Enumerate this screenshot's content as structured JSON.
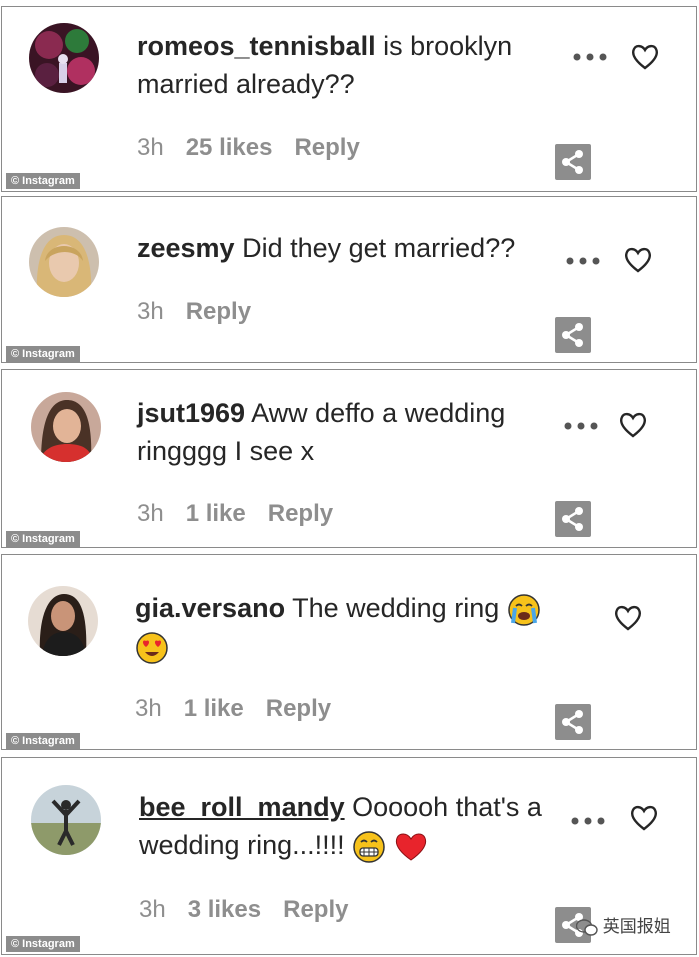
{
  "watermark": "© Instagram",
  "brand_mark": "英国报姐",
  "comments": [
    {
      "username": "romeos_tennisball",
      "text": "is brooklyn married already??",
      "time": "3h",
      "likes": "25 likes",
      "reply": "Reply",
      "avatar": "avatar-colorful-scene"
    },
    {
      "username": "zeesmy",
      "text": "Did they get married??",
      "time": "3h",
      "likes": "",
      "reply": "Reply",
      "avatar": "avatar-blonde-woman"
    },
    {
      "username": "jsut1969",
      "text": "Aww deffo a wedding ringggg I see x",
      "time": "3h",
      "likes": "1 like",
      "reply": "Reply",
      "avatar": "avatar-woman-red-top"
    },
    {
      "username": "gia.versano",
      "text": "The wedding ring",
      "time": "3h",
      "likes": "1 like",
      "reply": "Reply",
      "avatar": "avatar-dark-hair-woman"
    },
    {
      "username": "bee_roll_mandy",
      "text": "Oooooh that's a wedding ring...!!!!",
      "time": "3h",
      "likes": "3 likes",
      "reply": "Reply",
      "avatar": "avatar-person-outdoors"
    }
  ]
}
